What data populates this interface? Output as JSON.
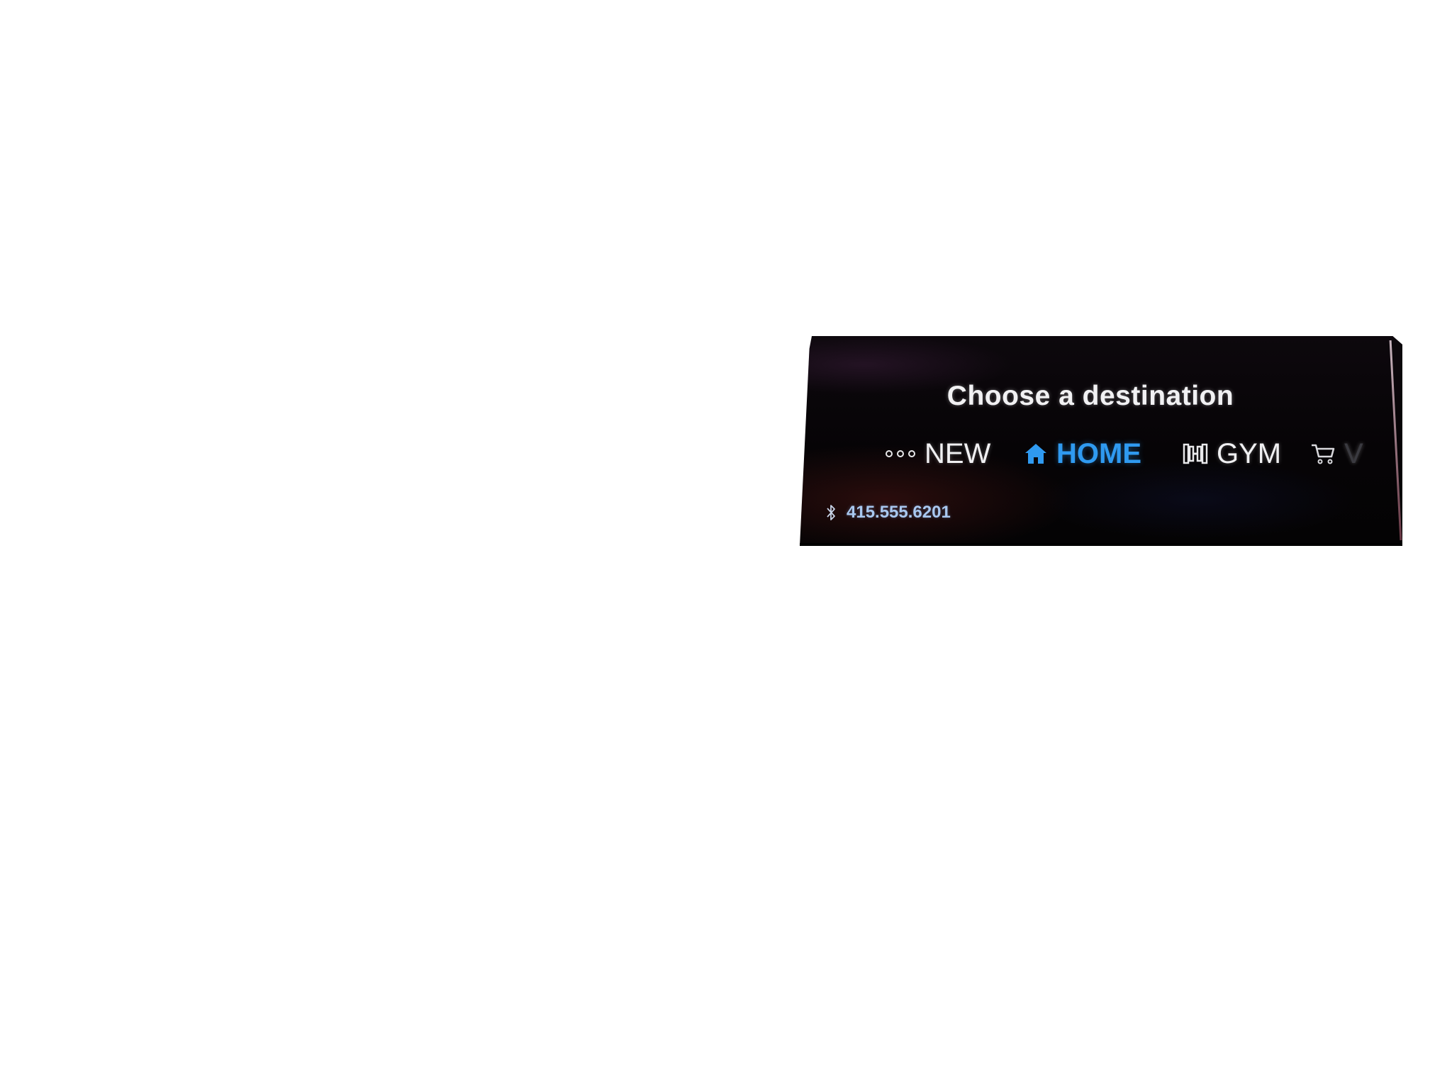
{
  "screen": {
    "title": "Choose a destination",
    "destinations": [
      {
        "label": "NEW",
        "icon": "more-dots-icon",
        "selected": false
      },
      {
        "label": "HOME",
        "icon": "home-icon",
        "selected": true
      },
      {
        "label": "GYM",
        "icon": "dumbbell-icon",
        "selected": false
      },
      {
        "label": "V",
        "icon": "shopping-cart-icon",
        "selected": false
      }
    ],
    "phone": {
      "icon": "bluetooth-icon",
      "number": "415.555.6201"
    }
  },
  "colors": {
    "background": "#ffffff",
    "display": "#060406",
    "text": "#f1f1f3",
    "accent": "#2f9af0",
    "phone_text": "#a9c8f0"
  }
}
